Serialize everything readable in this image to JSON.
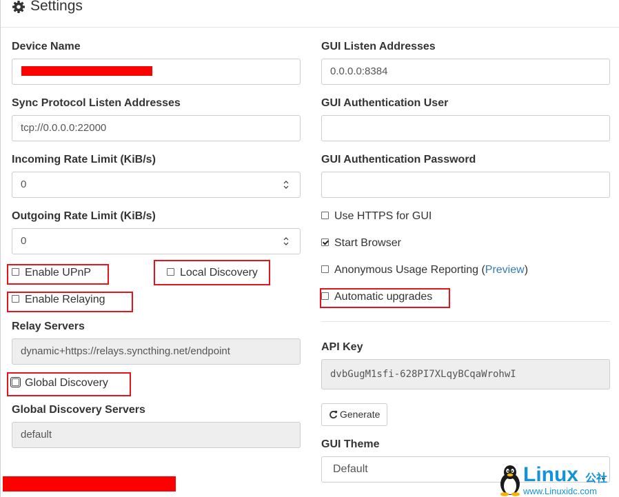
{
  "header": {
    "title": "Settings",
    "icon": "gear-icon"
  },
  "left": {
    "device_name": {
      "label": "Device Name",
      "value": ""
    },
    "sync_addresses": {
      "label": "Sync Protocol Listen Addresses",
      "value": "tcp://0.0.0.0:22000"
    },
    "incoming_rate": {
      "label": "Incoming Rate Limit (KiB/s)",
      "value": "0"
    },
    "outgoing_rate": {
      "label": "Outgoing Rate Limit (KiB/s)",
      "value": "0"
    },
    "enable_upnp": {
      "label": "Enable UPnP",
      "checked": false
    },
    "local_discovery": {
      "label": "Local Discovery",
      "checked": false
    },
    "enable_relaying": {
      "label": "Enable Relaying",
      "checked": false
    },
    "relay_servers": {
      "label": "Relay Servers",
      "value": "dynamic+https://relays.syncthing.net/endpoint"
    },
    "global_discovery": {
      "label": "Global Discovery",
      "checked": false
    },
    "global_discovery_servers": {
      "label": "Global Discovery Servers",
      "value": "default"
    }
  },
  "right": {
    "gui_listen": {
      "label": "GUI Listen Addresses",
      "value": "0.0.0.0:8384"
    },
    "gui_user": {
      "label": "GUI Authentication User",
      "value": ""
    },
    "gui_password": {
      "label": "GUI Authentication Password",
      "value": ""
    },
    "use_https": {
      "label": "Use HTTPS for GUI",
      "checked": false
    },
    "start_browser": {
      "label": "Start Browser",
      "checked": true
    },
    "anon_usage": {
      "label": "Anonymous Usage Reporting (",
      "link": "Preview",
      "suffix": ")",
      "checked": false
    },
    "auto_upgrades": {
      "label": "Automatic upgrades",
      "checked": false
    },
    "api_key": {
      "label": "API Key",
      "value": "dvbGugM1sfi-628PI7XLqyBCqaWrohwI"
    },
    "generate_button": "Generate",
    "gui_theme": {
      "label": "GUI Theme",
      "selected": "Default"
    }
  },
  "watermark": {
    "brand": "Linux",
    "suffix": "公社",
    "url": "www.Linuxidc.com"
  },
  "colors": {
    "highlight": "#e8111c",
    "redaction": "#ff0000",
    "link": "#337ab7",
    "watermark": "#1493d8"
  }
}
